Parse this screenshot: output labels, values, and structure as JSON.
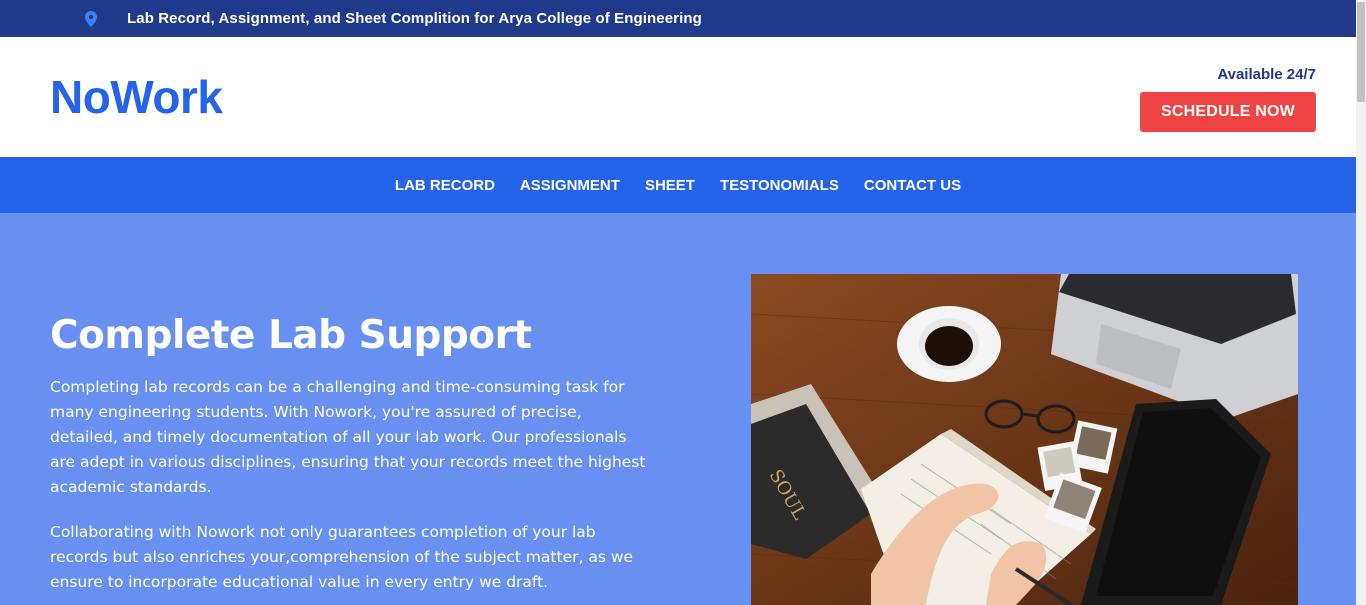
{
  "topbar": {
    "location_icon": "map-pin-icon",
    "text": "Lab Record, Assignment, and Sheet Complition for Arya College of Engineering"
  },
  "header": {
    "logo": "NoWork",
    "availability": "Available 24/7",
    "cta_label": "SCHEDULE NOW"
  },
  "nav": {
    "items": [
      "LAB RECORD",
      "ASSIGNMENT",
      "SHEET",
      "TESTONOMIALS",
      "CONTACT US"
    ]
  },
  "hero": {
    "title": "Complete Lab Support",
    "paragraph1": "Completing lab records can be a challenging and time-consuming task for many engineering students. With Nowork, you're assured of precise, detailed, and timely documentation of all your lab work. Our professionals are adept in various disciplines, ensuring that your records meet the highest academic standards.",
    "paragraph2": "Collaborating with Nowork not only guarantees completion of your lab records but also enriches your,comprehension of the subject matter, as we ensure to incorporate educational value in every entry we draft.",
    "book_title": "SOUL"
  },
  "colors": {
    "topbar": "#1f3a8a",
    "brand": "#2563eb",
    "cta": "#ef4444",
    "hero_bg": "#6790f0"
  }
}
